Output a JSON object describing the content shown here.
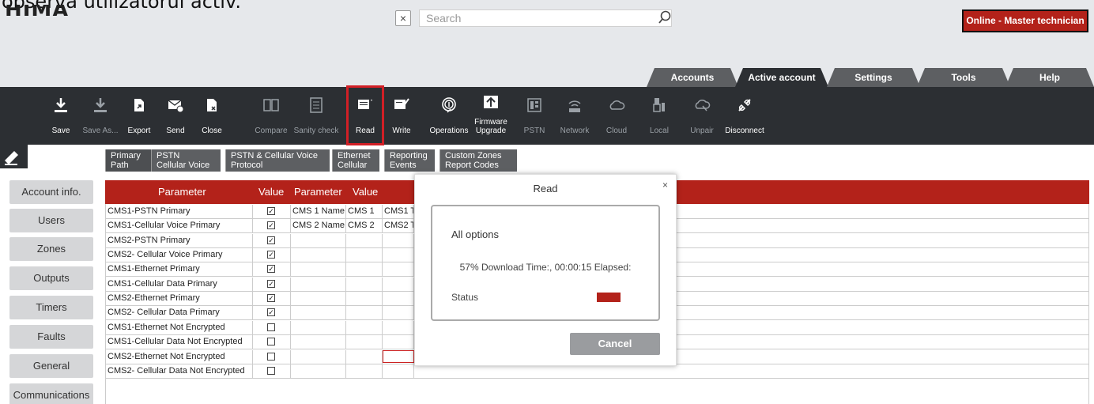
{
  "app": {
    "caption_text": "observă utilizatorul activ.",
    "logo_text": "HIMA",
    "search_placeholder": "Search",
    "search_clear": "×",
    "status_badge": "Online - Master technician"
  },
  "tabs": [
    {
      "label": "Accounts",
      "active": false
    },
    {
      "label": "Active account",
      "active": true
    },
    {
      "label": "Settings",
      "active": false
    },
    {
      "label": "Tools",
      "active": false
    },
    {
      "label": "Help",
      "active": false
    }
  ],
  "toolbar": {
    "save": {
      "label": "Save",
      "icon": "download-icon"
    },
    "save_as": {
      "label": "Save As...",
      "icon": "download-icon"
    },
    "export": {
      "label": "Export",
      "icon": "export-icon"
    },
    "send": {
      "label": "Send",
      "icon": "send-icon"
    },
    "close": {
      "label": "Close",
      "icon": "close-file-icon"
    },
    "compare": {
      "label": "Compare",
      "icon": "compare-icon"
    },
    "sanity": {
      "label": "Sanity check",
      "icon": "checklist-icon"
    },
    "read": {
      "label": "Read",
      "icon": "read-icon"
    },
    "write": {
      "label": "Write",
      "icon": "write-icon"
    },
    "operations": {
      "label": "Operations",
      "icon": "fingerprint-icon"
    },
    "firmware_line1": "Firmware",
    "firmware_line2": "Upgrade",
    "pstn": {
      "label": "PSTN",
      "icon": "pstn-icon"
    },
    "network": {
      "label": "Network",
      "icon": "network-icon"
    },
    "cloud": {
      "label": "Cloud",
      "icon": "cloud-icon"
    },
    "local": {
      "label": "Local",
      "icon": "usb-icon"
    },
    "unpair": {
      "label": "Unpair",
      "icon": "unpair-cloud-icon"
    },
    "disconnect": {
      "label": "Disconnect",
      "icon": "disconnect-icon"
    }
  },
  "nav": [
    "Account info.",
    "Users",
    "Zones",
    "Outputs",
    "Timers",
    "Faults",
    "General",
    "Communications"
  ],
  "subtabs": [
    {
      "line1": "Primary",
      "line2": "Path"
    },
    {
      "line1": "PSTN",
      "line2": "Cellular Voice"
    },
    {
      "line1": "PSTN & Cellular Voice",
      "line2": "Protocol"
    },
    {
      "line1": "Ethernet",
      "line2": "Cellular"
    },
    {
      "line1": "Reporting",
      "line2": "Events"
    },
    {
      "line1": "Custom Zones",
      "line2": "Report Codes"
    }
  ],
  "table": {
    "headers": [
      "Parameter",
      "Value",
      "Parameter",
      "Value"
    ],
    "rows": [
      {
        "param": "CMS1-PSTN Primary",
        "checked": true,
        "param2": "CMS 1 Name",
        "value2": "CMS 1",
        "extra": "CMS1 T"
      },
      {
        "param": "CMS1-Cellular Voice Primary",
        "checked": true,
        "param2": "CMS 2 Name",
        "value2": "CMS 2",
        "extra": "CMS2 T"
      },
      {
        "param": "CMS2-PSTN Primary",
        "checked": true,
        "param2": "",
        "value2": "",
        "extra": ""
      },
      {
        "param": "CMS2- Cellular Voice Primary",
        "checked": true,
        "param2": "",
        "value2": "",
        "extra": ""
      },
      {
        "param": "CMS1-Ethernet Primary",
        "checked": true,
        "param2": "",
        "value2": "",
        "extra": ""
      },
      {
        "param": "CMS1-Cellular Data Primary",
        "checked": true,
        "param2": "",
        "value2": "",
        "extra": ""
      },
      {
        "param": "CMS2-Ethernet Primary",
        "checked": true,
        "param2": "",
        "value2": "",
        "extra": ""
      },
      {
        "param": "CMS2- Cellular Data Primary",
        "checked": true,
        "param2": "",
        "value2": "",
        "extra": ""
      },
      {
        "param": "CMS1-Ethernet Not Encrypted",
        "checked": false,
        "param2": "",
        "value2": "",
        "extra": ""
      },
      {
        "param": "CMS1-Cellular Data Not Encrypted",
        "checked": false,
        "param2": "",
        "value2": "",
        "extra": ""
      },
      {
        "param": "CMS2-Ethernet Not Encrypted",
        "checked": false,
        "param2": "",
        "value2": "",
        "extra": ""
      },
      {
        "param": "CMS2- Cellular Data Not Encrypted",
        "checked": false,
        "param2": "",
        "value2": "",
        "extra": ""
      }
    ]
  },
  "modal": {
    "title": "Read",
    "close": "×",
    "option": "All options",
    "progress_text": "57% Download Time:, 00:00:15 Elapsed:",
    "progress": 0.57,
    "status_label": "Status",
    "cancel_label": "Cancel"
  },
  "colors": {
    "accent_red": "#b3221a",
    "toolbar_dark": "#2c2f33",
    "tab_grey": "#5d5f62",
    "nav_grey": "#d5d6d8"
  }
}
